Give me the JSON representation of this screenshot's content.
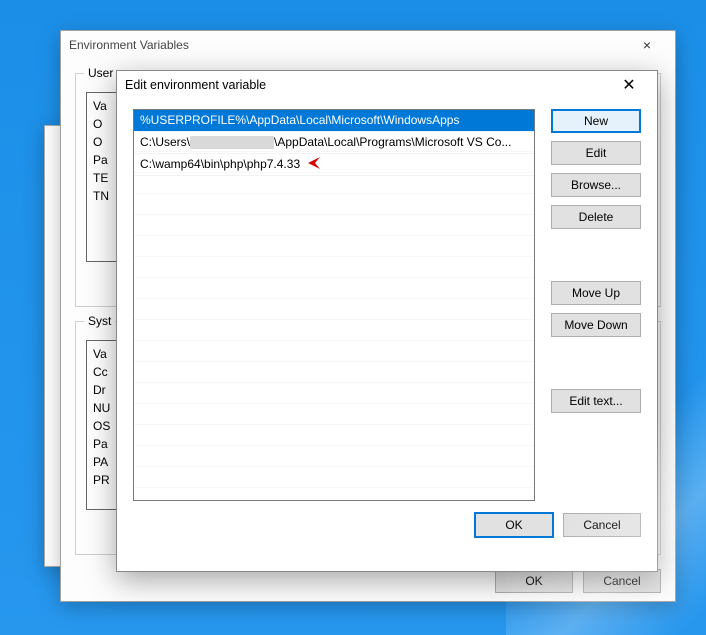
{
  "env_window": {
    "title": "Environment Variables",
    "user_group_label": "User",
    "user_rows": [
      "Va",
      "O",
      "O",
      "Pa",
      "TE",
      "TN"
    ],
    "sys_group_label": "Syst",
    "sys_rows": [
      "Va",
      "Cc",
      "Dr",
      "NU",
      "OS",
      "Pa",
      "PA",
      "PR"
    ],
    "ok": "OK",
    "cancel": "Cancel"
  },
  "edit_window": {
    "title": "Edit environment variable",
    "paths": [
      {
        "text": "%USERPROFILE%\\AppData\\Local\\Microsoft\\WindowsApps",
        "selected": true,
        "redacted": false
      },
      {
        "prefix": "C:\\Users\\",
        "redacted": true,
        "suffix": "\\AppData\\Local\\Programs\\Microsoft VS Co...",
        "selected": false
      },
      {
        "text": "C:\\wamp64\\bin\\php\\php7.4.33",
        "selected": false,
        "redacted": false,
        "arrow": true
      }
    ],
    "buttons": {
      "new": "New",
      "edit": "Edit",
      "browse": "Browse...",
      "delete": "Delete",
      "move_up": "Move Up",
      "move_down": "Move Down",
      "edit_text": "Edit text..."
    },
    "ok": "OK",
    "cancel": "Cancel"
  }
}
